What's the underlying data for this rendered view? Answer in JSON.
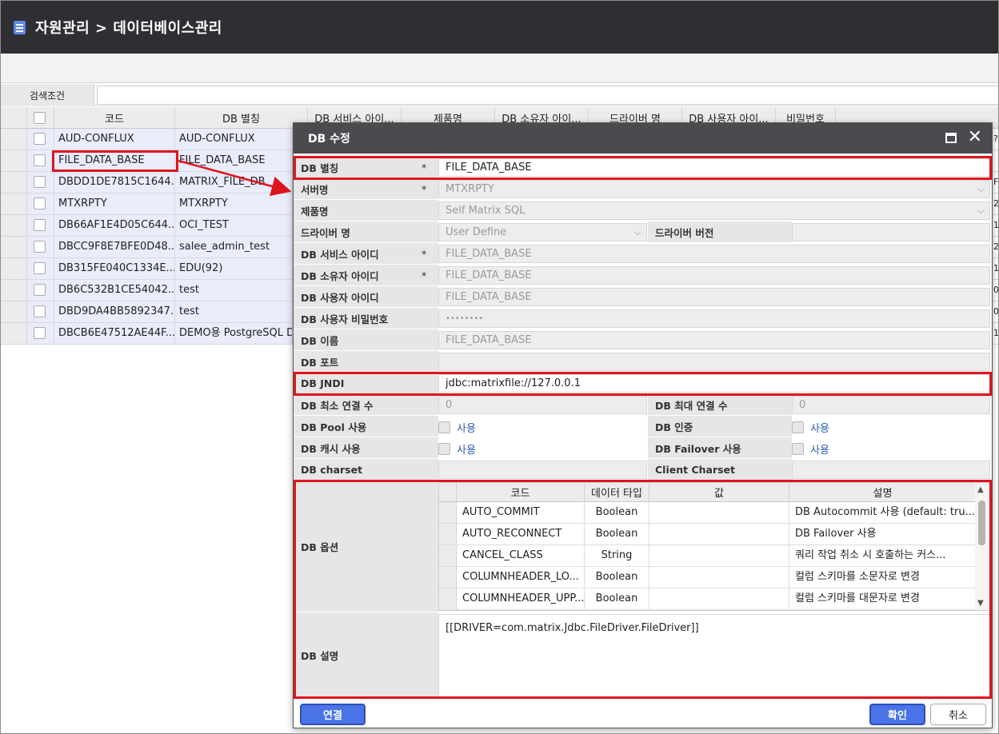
{
  "page": {
    "title": "자원관리 > 데이터베이스관리"
  },
  "search": {
    "label": "검색조건",
    "value": ""
  },
  "grid": {
    "headers": [
      "코드",
      "DB 별칭",
      "DB 서비스 아이...",
      "제품명",
      "DB 소유자 아이...",
      "드라이버 명",
      "DB 사용자 아이...",
      "비밀번호"
    ],
    "rows": [
      {
        "code": "AUD-CONFLUX",
        "alias": "AUD-CONFLUX",
        "edge": "?"
      },
      {
        "code": "FILE_DATA_BASE",
        "alias": "FILE_DATA_BASE",
        "edge": ""
      },
      {
        "code": "DBDD1DE7815C1644...",
        "alias": "MATRIX_FILE_DB",
        "edge": "FI"
      },
      {
        "code": "MTXRPTY",
        "alias": "MTXRPTY",
        "edge": "2"
      },
      {
        "code": "DB66AF1E4D05C644...",
        "alias": "OCI_TEST",
        "edge": "1"
      },
      {
        "code": "DBCC9F8E7BFE0D48...",
        "alias": "salee_admin_test",
        "edge": "2"
      },
      {
        "code": "DB315FE040C1334E...",
        "alias": "EDU(92)",
        "edge": "1"
      },
      {
        "code": "DB6C532B1CE54042...",
        "alias": "test",
        "edge": "0"
      },
      {
        "code": "DBD9DA4BB5892347...",
        "alias": "test",
        "edge": "0"
      },
      {
        "code": "DBCB6E47512AE44F...",
        "alias": "DEMO용 PostgreSQL D",
        "edge": "1"
      }
    ]
  },
  "dialog": {
    "title": "DB 수정",
    "required_mark": "*",
    "fields": {
      "db_alias": {
        "label": "DB 별칭",
        "value": "FILE_DATA_BASE"
      },
      "server": {
        "label": "서버명",
        "value": "MTXRPTY"
      },
      "product": {
        "label": "제품명",
        "value": "Self Matrix SQL"
      },
      "driver_name": {
        "label": "드라이버 명",
        "value": "User Define"
      },
      "driver_version": {
        "label": "드라이버 버전",
        "value": ""
      },
      "service_id": {
        "label": "DB 서비스 아이디",
        "value": "FILE_DATA_BASE"
      },
      "owner_id": {
        "label": "DB 소유자 아이디",
        "value": "FILE_DATA_BASE"
      },
      "user_id": {
        "label": "DB 사용자 아이디",
        "value": "FILE_DATA_BASE"
      },
      "user_pw": {
        "label": "DB 사용자 비밀번호",
        "value": "••••••••"
      },
      "db_name": {
        "label": "DB 이름",
        "value": "FILE_DATA_BASE"
      },
      "port": {
        "label": "DB 포트",
        "value": ""
      },
      "jndi": {
        "label": "DB JNDI",
        "value": "jdbc:matrixfile://127.0.0.1"
      },
      "min_conn": {
        "label": "DB 최소 연결 수",
        "value": "0"
      },
      "max_conn": {
        "label": "DB 최대 연결 수",
        "value": "0"
      },
      "pool": {
        "label": "DB Pool 사용",
        "check": "사용"
      },
      "auth": {
        "label": "DB 인증",
        "check": "사용"
      },
      "cache": {
        "label": "DB 캐시 사용",
        "check": "사용"
      },
      "failover": {
        "label": "DB Failover 사용",
        "check": "사용"
      },
      "charset": {
        "label": "DB charset",
        "value": ""
      },
      "client_charset": {
        "label": "Client Charset",
        "value": ""
      },
      "options_label": "DB 옵션",
      "desc_label": "DB 설명",
      "desc_value": "[[DRIVER=com.matrix.Jdbc.FileDriver.FileDriver]]"
    },
    "options": {
      "headers": [
        "코드",
        "데이터 타입",
        "값",
        "설명"
      ],
      "rows": [
        {
          "code": "AUTO_COMMIT",
          "type": "Boolean",
          "value": "",
          "desc": "DB Autocommit 사용 (default: tru..."
        },
        {
          "code": "AUTO_RECONNECT",
          "type": "Boolean",
          "value": "",
          "desc": "DB Failover 사용"
        },
        {
          "code": "CANCEL_CLASS",
          "type": "String",
          "value": "",
          "desc": "쿼리 작업 취소 시 호출하는 커스..."
        },
        {
          "code": "COLUMNHEADER_LO...",
          "type": "Boolean",
          "value": "",
          "desc": "컬럼 스키마를 소문자로 변경"
        },
        {
          "code": "COLUMNHEADER_UPP...",
          "type": "Boolean",
          "value": "",
          "desc": "컬럼 스키마를 대문자로 변경"
        }
      ]
    },
    "buttons": {
      "connect": "연결",
      "ok": "확인",
      "cancel": "취소"
    }
  },
  "colors": {
    "titlebar": "#2f2f33",
    "dialog_title": "#4b4b4f",
    "highlight": "#e0141e",
    "primary_button": "#4a73e8",
    "row_bg": "#e9ecfb"
  }
}
